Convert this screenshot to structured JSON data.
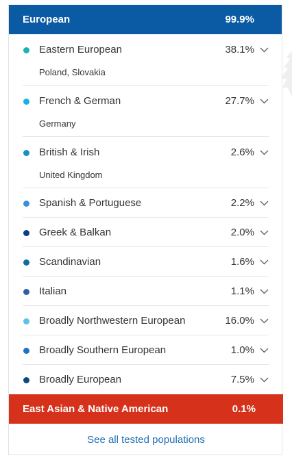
{
  "header": {
    "label": "European",
    "percent": "99.9%",
    "color": "#0a5ba3"
  },
  "rows": [
    {
      "name": "Eastern European",
      "percent": "38.1%",
      "sub": "Poland, Slovakia",
      "color": "#19b3b1"
    },
    {
      "name": "French & German",
      "percent": "27.7%",
      "sub": "Germany",
      "color": "#17b2e0"
    },
    {
      "name": "British & Irish",
      "percent": "2.6%",
      "sub": "United Kingdom",
      "color": "#1591c4"
    },
    {
      "name": "Spanish & Portuguese",
      "percent": "2.2%",
      "color": "#3a8fdb"
    },
    {
      "name": "Greek & Balkan",
      "percent": "2.0%",
      "color": "#0d3c8c"
    },
    {
      "name": "Scandinavian",
      "percent": "1.6%",
      "color": "#0f6e9e"
    },
    {
      "name": "Italian",
      "percent": "1.1%",
      "color": "#2e5fa8"
    },
    {
      "name": "Broadly Northwestern European",
      "percent": "16.0%",
      "color": "#5cc3e8"
    },
    {
      "name": "Broadly Southern European",
      "percent": "1.0%",
      "color": "#1f73c4"
    },
    {
      "name": "Broadly European",
      "percent": "7.5%",
      "color": "#0c4a7a"
    }
  ],
  "region2": {
    "label": "East Asian & Native American",
    "percent": "0.1%",
    "color": "#d6321b"
  },
  "footer": {
    "link": "See all tested populations"
  },
  "icons": {
    "expand": "chevron-down-icon"
  }
}
